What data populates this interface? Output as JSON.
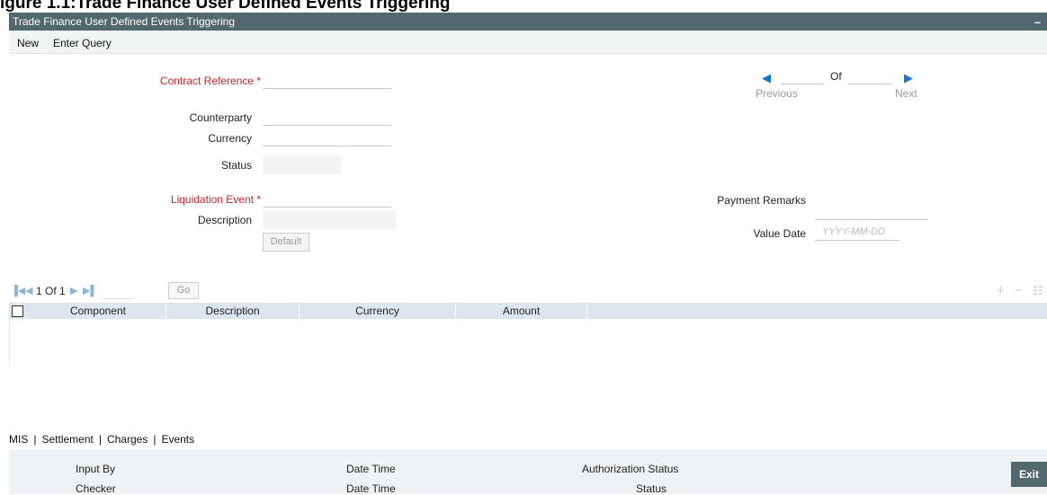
{
  "caption": "igure 1.1:Trade Finance User Defined Events Triggering",
  "window": {
    "title": "Trade Finance User Defined Events Triggering",
    "minimize_label": "–"
  },
  "menu": {
    "new": "New",
    "enter_query": "Enter Query"
  },
  "form": {
    "contract_reference": {
      "label": "Contract Reference",
      "required_mark": "*",
      "value": ""
    },
    "counterparty": {
      "label": "Counterparty",
      "value": ""
    },
    "currency": {
      "label": "Currency",
      "value": ""
    },
    "status": {
      "label": "Status",
      "value": ""
    },
    "liquidation_event": {
      "label": "Liquidation Event",
      "required_mark": "*",
      "value": ""
    },
    "description": {
      "label": "Description",
      "value": ""
    },
    "default_button": "Default",
    "payment_remarks": {
      "label": "Payment Remarks",
      "value": ""
    },
    "value_date": {
      "label": "Value Date",
      "placeholder": "YYYY-MM-DD"
    }
  },
  "record_pager": {
    "previous": "Previous",
    "of": "Of",
    "next": "Next",
    "current": "",
    "total": ""
  },
  "grid": {
    "pager_text": "1 Of 1",
    "go": "Go",
    "columns": [
      "Component",
      "Description",
      "Currency",
      "Amount"
    ],
    "rows": []
  },
  "footer_tabs": [
    "MIS",
    "Settlement",
    "Charges",
    "Events"
  ],
  "audit": {
    "input_by": "Input By",
    "date_time_1": "Date Time",
    "authorization_status": "Authorization Status",
    "checker": "Checker",
    "date_time_2": "Date Time",
    "status": "Status"
  },
  "exit_label": "Exit",
  "colors": {
    "titlebar": "#53676f",
    "required": "#c0262a",
    "grid_header": "#dde5ee",
    "pager_arrow": "#1a73c9"
  }
}
